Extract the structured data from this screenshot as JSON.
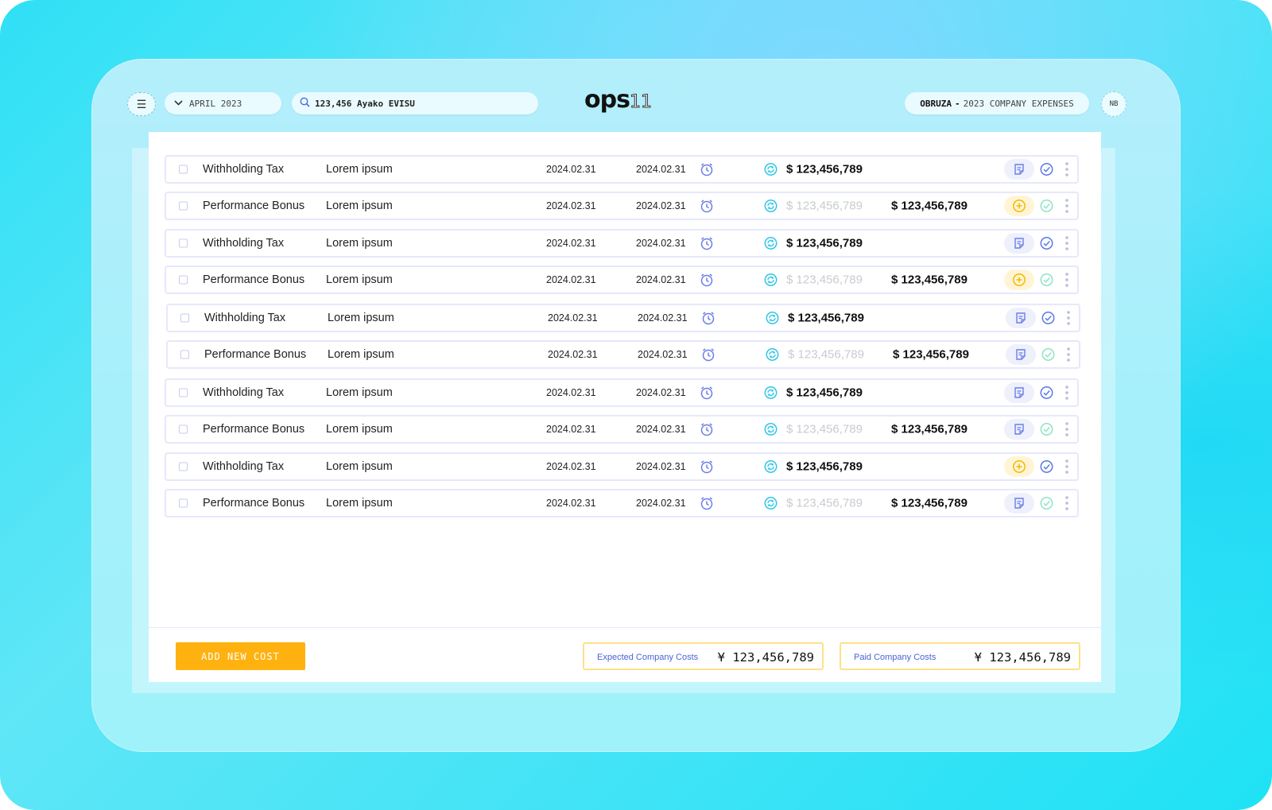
{
  "header": {
    "month": "APRIL 2023",
    "search_value": "123,456 Ayako EVISU",
    "logo_main": "ops",
    "logo_sup": "11",
    "company_name": "OBRUZA",
    "company_separator": "-",
    "company_sheet": "2023 COMPANY EXPENSES",
    "avatar_initials": "NB"
  },
  "colors": {
    "accent_blue": "#4a63d8",
    "accent_yellow": "#ffb20f",
    "icon_cyan": "#2ec7e6",
    "icon_purple": "#6b7de8"
  },
  "rows": [
    {
      "name": "Withholding Tax",
      "desc": "Lorem ipsum",
      "date1": "2024.02.31",
      "date2": "2024.02.31",
      "amount1": "$ 123,456,789",
      "amount1_muted": false,
      "amount2": "",
      "action": "note",
      "check": "blue"
    },
    {
      "name": "Performance Bonus",
      "desc": "Lorem ipsum",
      "date1": "2024.02.31",
      "date2": "2024.02.31",
      "amount1": "$ 123,456,789",
      "amount1_muted": true,
      "amount2": "$ 123,456,789",
      "action": "add",
      "check": "green"
    },
    {
      "name": "Withholding Tax",
      "desc": "Lorem ipsum",
      "date1": "2024.02.31",
      "date2": "2024.02.31",
      "amount1": "$ 123,456,789",
      "amount1_muted": false,
      "amount2": "",
      "action": "note",
      "check": "blue"
    },
    {
      "name": "Performance Bonus",
      "desc": "Lorem ipsum",
      "date1": "2024.02.31",
      "date2": "2024.02.31",
      "amount1": "$ 123,456,789",
      "amount1_muted": true,
      "amount2": "$ 123,456,789",
      "action": "add",
      "check": "green"
    },
    {
      "name": "Withholding Tax",
      "desc": "Lorem ipsum",
      "date1": "2024.02.31",
      "date2": "2024.02.31",
      "amount1": "$ 123,456,789",
      "amount1_muted": false,
      "amount2": "",
      "action": "note",
      "check": "blue"
    },
    {
      "name": "Performance Bonus",
      "desc": "Lorem ipsum",
      "date1": "2024.02.31",
      "date2": "2024.02.31",
      "amount1": "$ 123,456,789",
      "amount1_muted": true,
      "amount2": "$ 123,456,789",
      "action": "note",
      "check": "green"
    },
    {
      "name": "Withholding Tax",
      "desc": "Lorem ipsum",
      "date1": "2024.02.31",
      "date2": "2024.02.31",
      "amount1": "$ 123,456,789",
      "amount1_muted": false,
      "amount2": "",
      "action": "note",
      "check": "blue"
    },
    {
      "name": "Performance Bonus",
      "desc": "Lorem ipsum",
      "date1": "2024.02.31",
      "date2": "2024.02.31",
      "amount1": "$ 123,456,789",
      "amount1_muted": true,
      "amount2": "$ 123,456,789",
      "action": "note",
      "check": "green"
    },
    {
      "name": "Withholding Tax",
      "desc": "Lorem ipsum",
      "date1": "2024.02.31",
      "date2": "2024.02.31",
      "amount1": "$ 123,456,789",
      "amount1_muted": false,
      "amount2": "",
      "action": "add",
      "check": "blue"
    },
    {
      "name": "Performance Bonus",
      "desc": "Lorem ipsum",
      "date1": "2024.02.31",
      "date2": "2024.02.31",
      "amount1": "$ 123,456,789",
      "amount1_muted": true,
      "amount2": "$ 123,456,789",
      "action": "note",
      "check": "green"
    }
  ],
  "footer": {
    "add_button_label": "ADD NEW COST",
    "expected_label": "Expected Company Costs",
    "expected_value": "¥ 123,456,789",
    "paid_label": "Paid Company Costs",
    "paid_value": "¥ 123,456,789"
  }
}
